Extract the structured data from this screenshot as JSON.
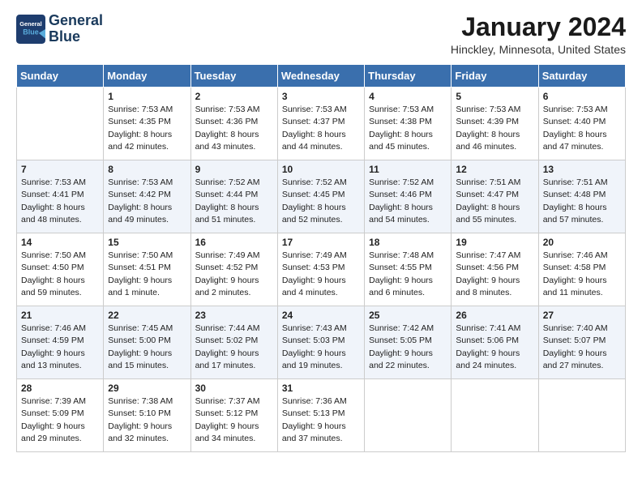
{
  "header": {
    "logo_line1": "General",
    "logo_line2": "Blue",
    "month": "January 2024",
    "location": "Hinckley, Minnesota, United States"
  },
  "weekdays": [
    "Sunday",
    "Monday",
    "Tuesday",
    "Wednesday",
    "Thursday",
    "Friday",
    "Saturday"
  ],
  "weeks": [
    [
      {
        "day": "",
        "sunrise": "",
        "sunset": "",
        "daylight": ""
      },
      {
        "day": "1",
        "sunrise": "Sunrise: 7:53 AM",
        "sunset": "Sunset: 4:35 PM",
        "daylight": "Daylight: 8 hours and 42 minutes."
      },
      {
        "day": "2",
        "sunrise": "Sunrise: 7:53 AM",
        "sunset": "Sunset: 4:36 PM",
        "daylight": "Daylight: 8 hours and 43 minutes."
      },
      {
        "day": "3",
        "sunrise": "Sunrise: 7:53 AM",
        "sunset": "Sunset: 4:37 PM",
        "daylight": "Daylight: 8 hours and 44 minutes."
      },
      {
        "day": "4",
        "sunrise": "Sunrise: 7:53 AM",
        "sunset": "Sunset: 4:38 PM",
        "daylight": "Daylight: 8 hours and 45 minutes."
      },
      {
        "day": "5",
        "sunrise": "Sunrise: 7:53 AM",
        "sunset": "Sunset: 4:39 PM",
        "daylight": "Daylight: 8 hours and 46 minutes."
      },
      {
        "day": "6",
        "sunrise": "Sunrise: 7:53 AM",
        "sunset": "Sunset: 4:40 PM",
        "daylight": "Daylight: 8 hours and 47 minutes."
      }
    ],
    [
      {
        "day": "7",
        "sunrise": "Sunrise: 7:53 AM",
        "sunset": "Sunset: 4:41 PM",
        "daylight": "Daylight: 8 hours and 48 minutes."
      },
      {
        "day": "8",
        "sunrise": "Sunrise: 7:53 AM",
        "sunset": "Sunset: 4:42 PM",
        "daylight": "Daylight: 8 hours and 49 minutes."
      },
      {
        "day": "9",
        "sunrise": "Sunrise: 7:52 AM",
        "sunset": "Sunset: 4:44 PM",
        "daylight": "Daylight: 8 hours and 51 minutes."
      },
      {
        "day": "10",
        "sunrise": "Sunrise: 7:52 AM",
        "sunset": "Sunset: 4:45 PM",
        "daylight": "Daylight: 8 hours and 52 minutes."
      },
      {
        "day": "11",
        "sunrise": "Sunrise: 7:52 AM",
        "sunset": "Sunset: 4:46 PM",
        "daylight": "Daylight: 8 hours and 54 minutes."
      },
      {
        "day": "12",
        "sunrise": "Sunrise: 7:51 AM",
        "sunset": "Sunset: 4:47 PM",
        "daylight": "Daylight: 8 hours and 55 minutes."
      },
      {
        "day": "13",
        "sunrise": "Sunrise: 7:51 AM",
        "sunset": "Sunset: 4:48 PM",
        "daylight": "Daylight: 8 hours and 57 minutes."
      }
    ],
    [
      {
        "day": "14",
        "sunrise": "Sunrise: 7:50 AM",
        "sunset": "Sunset: 4:50 PM",
        "daylight": "Daylight: 8 hours and 59 minutes."
      },
      {
        "day": "15",
        "sunrise": "Sunrise: 7:50 AM",
        "sunset": "Sunset: 4:51 PM",
        "daylight": "Daylight: 9 hours and 1 minute."
      },
      {
        "day": "16",
        "sunrise": "Sunrise: 7:49 AM",
        "sunset": "Sunset: 4:52 PM",
        "daylight": "Daylight: 9 hours and 2 minutes."
      },
      {
        "day": "17",
        "sunrise": "Sunrise: 7:49 AM",
        "sunset": "Sunset: 4:53 PM",
        "daylight": "Daylight: 9 hours and 4 minutes."
      },
      {
        "day": "18",
        "sunrise": "Sunrise: 7:48 AM",
        "sunset": "Sunset: 4:55 PM",
        "daylight": "Daylight: 9 hours and 6 minutes."
      },
      {
        "day": "19",
        "sunrise": "Sunrise: 7:47 AM",
        "sunset": "Sunset: 4:56 PM",
        "daylight": "Daylight: 9 hours and 8 minutes."
      },
      {
        "day": "20",
        "sunrise": "Sunrise: 7:46 AM",
        "sunset": "Sunset: 4:58 PM",
        "daylight": "Daylight: 9 hours and 11 minutes."
      }
    ],
    [
      {
        "day": "21",
        "sunrise": "Sunrise: 7:46 AM",
        "sunset": "Sunset: 4:59 PM",
        "daylight": "Daylight: 9 hours and 13 minutes."
      },
      {
        "day": "22",
        "sunrise": "Sunrise: 7:45 AM",
        "sunset": "Sunset: 5:00 PM",
        "daylight": "Daylight: 9 hours and 15 minutes."
      },
      {
        "day": "23",
        "sunrise": "Sunrise: 7:44 AM",
        "sunset": "Sunset: 5:02 PM",
        "daylight": "Daylight: 9 hours and 17 minutes."
      },
      {
        "day": "24",
        "sunrise": "Sunrise: 7:43 AM",
        "sunset": "Sunset: 5:03 PM",
        "daylight": "Daylight: 9 hours and 19 minutes."
      },
      {
        "day": "25",
        "sunrise": "Sunrise: 7:42 AM",
        "sunset": "Sunset: 5:05 PM",
        "daylight": "Daylight: 9 hours and 22 minutes."
      },
      {
        "day": "26",
        "sunrise": "Sunrise: 7:41 AM",
        "sunset": "Sunset: 5:06 PM",
        "daylight": "Daylight: 9 hours and 24 minutes."
      },
      {
        "day": "27",
        "sunrise": "Sunrise: 7:40 AM",
        "sunset": "Sunset: 5:07 PM",
        "daylight": "Daylight: 9 hours and 27 minutes."
      }
    ],
    [
      {
        "day": "28",
        "sunrise": "Sunrise: 7:39 AM",
        "sunset": "Sunset: 5:09 PM",
        "daylight": "Daylight: 9 hours and 29 minutes."
      },
      {
        "day": "29",
        "sunrise": "Sunrise: 7:38 AM",
        "sunset": "Sunset: 5:10 PM",
        "daylight": "Daylight: 9 hours and 32 minutes."
      },
      {
        "day": "30",
        "sunrise": "Sunrise: 7:37 AM",
        "sunset": "Sunset: 5:12 PM",
        "daylight": "Daylight: 9 hours and 34 minutes."
      },
      {
        "day": "31",
        "sunrise": "Sunrise: 7:36 AM",
        "sunset": "Sunset: 5:13 PM",
        "daylight": "Daylight: 9 hours and 37 minutes."
      },
      {
        "day": "",
        "sunrise": "",
        "sunset": "",
        "daylight": ""
      },
      {
        "day": "",
        "sunrise": "",
        "sunset": "",
        "daylight": ""
      },
      {
        "day": "",
        "sunrise": "",
        "sunset": "",
        "daylight": ""
      }
    ]
  ]
}
